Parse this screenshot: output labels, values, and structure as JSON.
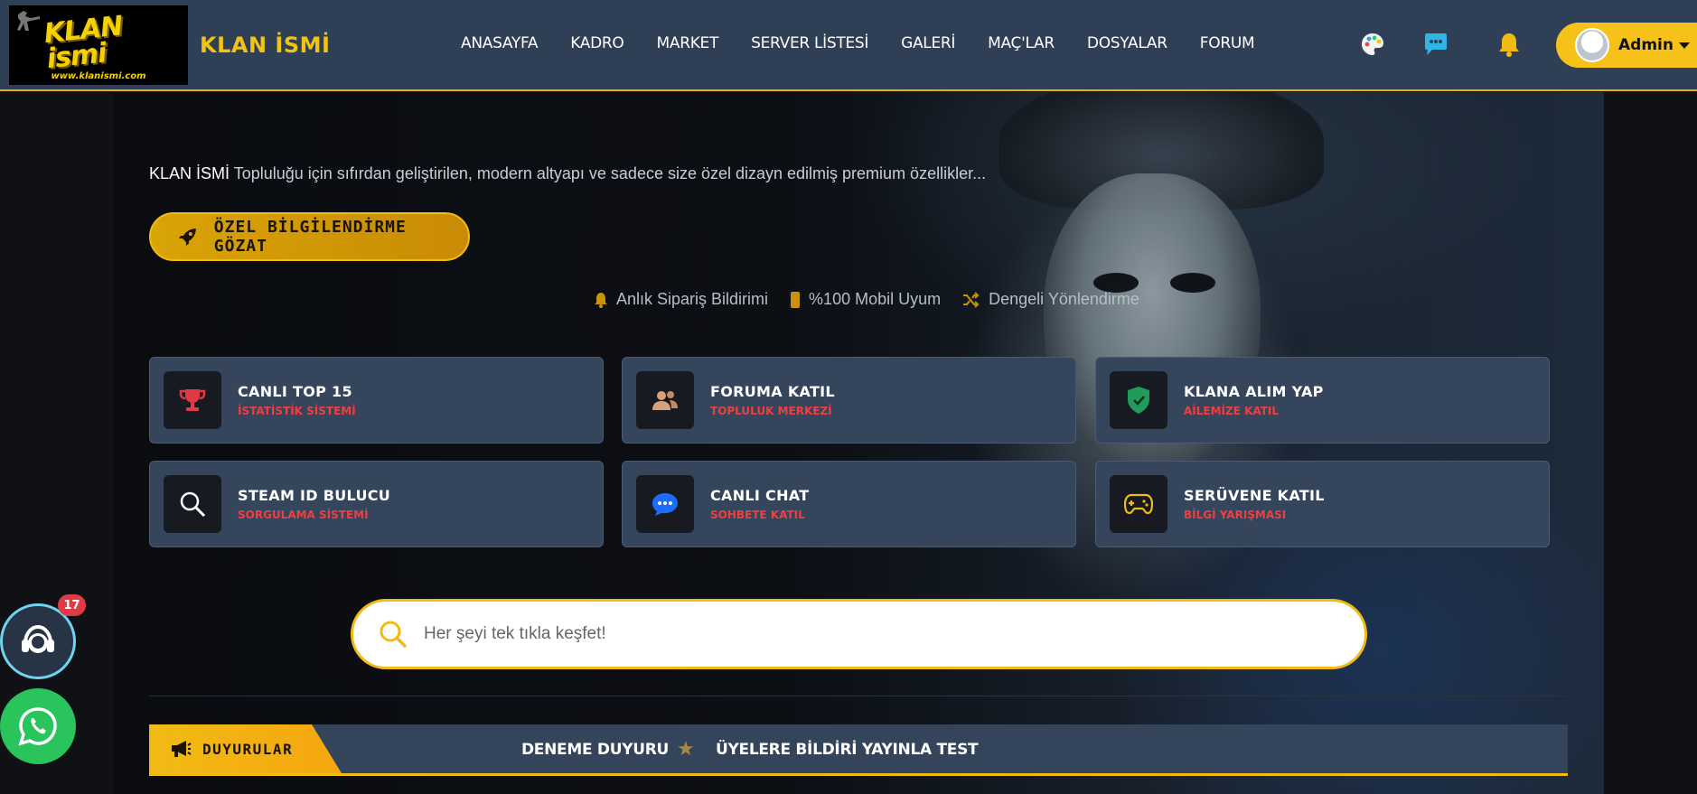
{
  "header": {
    "logo": {
      "main_text": "KLAN ismi",
      "sub_text": "www.klanismi.com"
    },
    "brand_title": "KLAN İSMİ",
    "nav": [
      "ANASAYFA",
      "KADRO",
      "MARKET",
      "SERVER LİSTESİ",
      "GALERİ",
      "MAÇ'LAR",
      "DOSYALAR",
      "FORUM"
    ],
    "icons": [
      "palette-icon",
      "chat-icon",
      "bell-icon"
    ],
    "user": {
      "name": "Admin"
    }
  },
  "hero": {
    "tagline_brand": "KLAN İSMİ",
    "tagline_rest": " Topluluğu için sıfırdan geliştirilen, modern altyapı ve sadece size özel dizayn edilmiş premium özellikler...",
    "cta_label": "ÖZEL BİLGİLENDİRME GÖZAT",
    "features": [
      {
        "icon": "bell-icon",
        "label": "Anlık Sipariş Bildirimi"
      },
      {
        "icon": "mobile-icon",
        "label": "%100 Mobil Uyum"
      },
      {
        "icon": "shuffle-icon",
        "label": "Dengeli Yönlendirme"
      }
    ]
  },
  "cards": [
    {
      "title": "CANLI TOP 15",
      "subtitle": "İSTATİSTİK SİSTEMİ",
      "icon": "trophy-icon"
    },
    {
      "title": "FORUMA KATIL",
      "subtitle": "TOPLULUK MERKEZİ",
      "icon": "users-icon"
    },
    {
      "title": "KLANA ALIM YAP",
      "subtitle": "AİLEMİZE KATIL",
      "icon": "shield-icon"
    },
    {
      "title": "STEAM ID BULUCU",
      "subtitle": "SORGULAMA SİSTEMİ",
      "icon": "search-icon"
    },
    {
      "title": "CANLI CHAT",
      "subtitle": "SOHBETE KATIL",
      "icon": "chat-bubble-icon"
    },
    {
      "title": "SERÜVENE KATIL",
      "subtitle": "BİLGİ YARIŞMASI",
      "icon": "gamepad-icon"
    }
  ],
  "search": {
    "placeholder": "Her şeyi tek tıkla keşfet!"
  },
  "announcements": {
    "label": "DUYURULAR",
    "items": [
      "DENEME DUYURU",
      "ÜYELERE BİLDİRİ YAYINLA TEST"
    ]
  },
  "floating": {
    "support_badge": "17"
  },
  "colors": {
    "accent": "#f1bb14",
    "header_bg": "#2f3f55",
    "card_bg": "#35455c",
    "subtitle_red": "#ef3f3f"
  }
}
